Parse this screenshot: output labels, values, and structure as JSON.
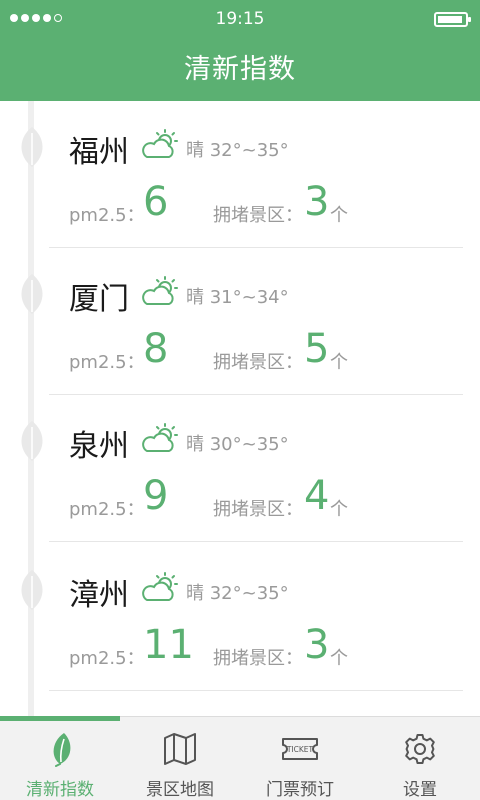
{
  "status_bar": {
    "time": "19:15"
  },
  "header": {
    "title": "清新指数"
  },
  "labels": {
    "pm": "pm2.5：",
    "jam": "拥堵景区：",
    "unit": "个"
  },
  "cities": [
    {
      "name": "福州",
      "weather": "晴 32°~35°",
      "pm25": "6",
      "jam": "3"
    },
    {
      "name": "厦门",
      "weather": "晴 31°~34°",
      "pm25": "8",
      "jam": "5"
    },
    {
      "name": "泉州",
      "weather": "晴 30°~35°",
      "pm25": "9",
      "jam": "4"
    },
    {
      "name": "漳州",
      "weather": "晴 32°~35°",
      "pm25": "11",
      "jam": "3"
    }
  ],
  "tabs": [
    {
      "label": "清新指数",
      "icon": "leaf-icon",
      "active": true
    },
    {
      "label": "景区地图",
      "icon": "map-icon",
      "active": false
    },
    {
      "label": "门票预订",
      "icon": "ticket-icon",
      "active": false
    },
    {
      "label": "设置",
      "icon": "gear-icon",
      "active": false
    }
  ],
  "ticket_icon_text": "TICKET",
  "colors": {
    "accent": "#5bb072",
    "text_muted": "#9a9a9a",
    "timeline": "#efefef"
  }
}
